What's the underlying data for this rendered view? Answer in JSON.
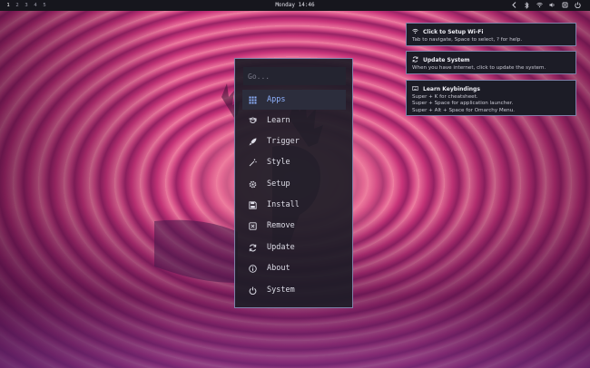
{
  "topbar": {
    "workspaces": [
      "1",
      "2",
      "3",
      "4",
      "5"
    ],
    "active_workspace": "1",
    "clock": "Monday 14:46",
    "tray_icons": [
      "chevron-left-icon",
      "bluetooth-icon",
      "wifi-icon",
      "volume-icon",
      "cpu-icon",
      "power-icon"
    ]
  },
  "menu": {
    "search_placeholder": "Go...",
    "items": [
      {
        "label": "Apps",
        "icon": "grid-icon",
        "selected": true
      },
      {
        "label": "Learn",
        "icon": "learn-icon"
      },
      {
        "label": "Trigger",
        "icon": "rocket-icon"
      },
      {
        "label": "Style",
        "icon": "wand-icon"
      },
      {
        "label": "Setup",
        "icon": "gear-icon"
      },
      {
        "label": "Install",
        "icon": "floppy-icon"
      },
      {
        "label": "Remove",
        "icon": "remove-icon"
      },
      {
        "label": "Update",
        "icon": "refresh-icon"
      },
      {
        "label": "About",
        "icon": "info-icon"
      },
      {
        "label": "System",
        "icon": "power-icon"
      }
    ],
    "accent_color": "#8fb2ff"
  },
  "notifications": [
    {
      "title": "Click to Setup Wi-Fi",
      "icon": "wifi-icon",
      "lines": [
        "Tab to navigate, Space to select, ? for help."
      ]
    },
    {
      "title": "Update System",
      "icon": "refresh-icon",
      "lines": [
        "When you have internet, click to update the system."
      ]
    },
    {
      "title": "Learn Keybindings",
      "icon": "keyboard-icon",
      "lines": [
        "Super + K for cheatsheet.",
        "Super + Space for application launcher.",
        "Super + Alt + Space for Omarchy Menu."
      ]
    }
  ]
}
